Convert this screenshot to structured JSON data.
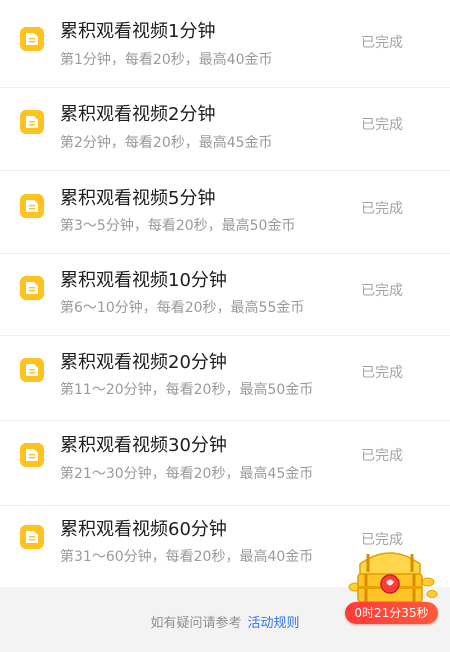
{
  "tasks": [
    {
      "title": "累积观看视频1分钟",
      "desc": "第1分钟，每看20秒，最高40金币",
      "status": "已完成"
    },
    {
      "title": "累积观看视频2分钟",
      "desc": "第2分钟，每看20秒，最高45金币",
      "status": "已完成"
    },
    {
      "title": "累积观看视频5分钟",
      "desc": "第3～5分钟，每看20秒，最高50金币",
      "status": "已完成"
    },
    {
      "title": "累积观看视频10分钟",
      "desc": "第6～10分钟，每看20秒，最高55金币",
      "status": "已完成"
    },
    {
      "title": "累积观看视频20分钟",
      "desc": "第11～20分钟，每看20秒，最高50金币",
      "status": "已完成"
    },
    {
      "title": "累积观看视频30分钟",
      "desc": "第21～30分钟，每看20秒，最高45金币",
      "status": "已完成"
    },
    {
      "title": "累积观看视频60分钟",
      "desc": "第31～60分钟，每看20秒，最高40金币",
      "status": "已完成"
    }
  ],
  "footer": {
    "hint": "如有疑问请参考",
    "link": "活动规则"
  },
  "reward_widget": {
    "countdown": "0时21分35秒",
    "icon": "treasure-chest-icon"
  },
  "colors": {
    "icon_yellow": "#ffc31f",
    "status_gray": "#a5a5a5",
    "link_blue": "#2f75e8",
    "badge_red": "#ff3b38"
  }
}
